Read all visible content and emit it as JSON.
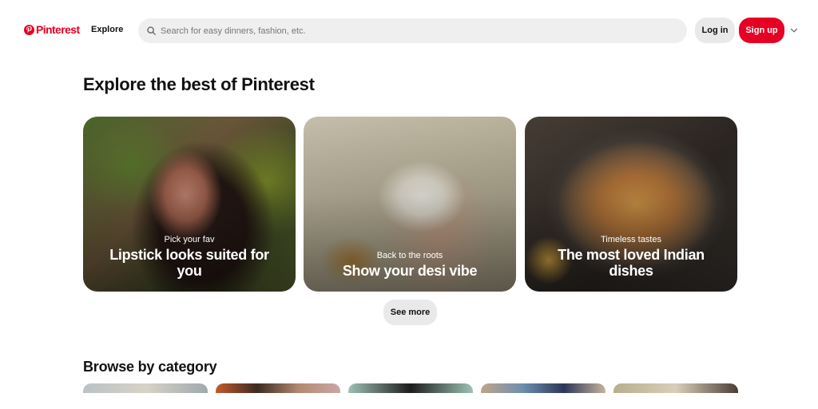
{
  "header": {
    "logo_text": "Pinterest",
    "nav_explore": "Explore",
    "search_placeholder": "Search for easy dinners, fashion, etc.",
    "login_label": "Log in",
    "signup_label": "Sign up"
  },
  "main": {
    "title": "Explore the best of Pinterest",
    "cards": [
      {
        "subtitle": "Pick your fav",
        "title": "Lipstick looks suited for you"
      },
      {
        "subtitle": "Back to the roots",
        "title": "Show your desi vibe"
      },
      {
        "subtitle": "Timeless tastes",
        "title": "The most loved Indian dishes"
      }
    ],
    "see_more_label": "See more"
  },
  "browse": {
    "title": "Browse by category"
  },
  "colors": {
    "brand": "#e60023",
    "button_gray": "#e9e9e9",
    "search_bg": "#efefef"
  },
  "icons": [
    "pinterest-logo-icon",
    "search-icon",
    "chevron-down-icon"
  ]
}
